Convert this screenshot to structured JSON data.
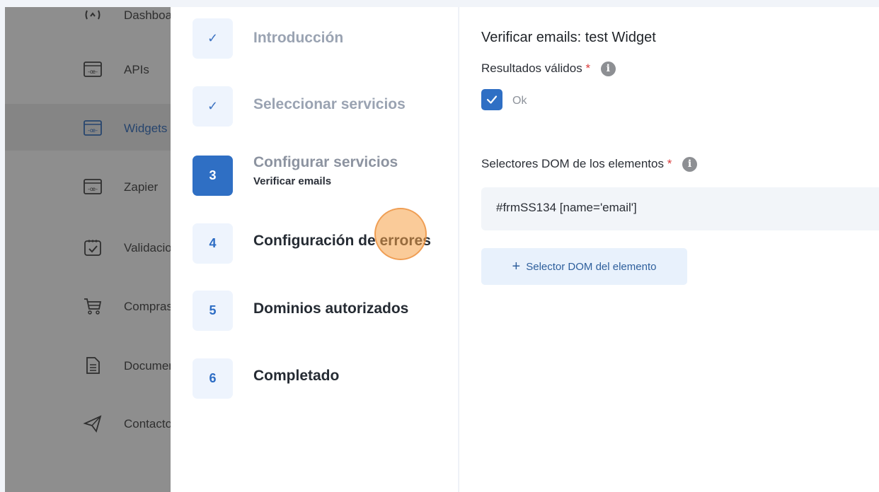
{
  "sidebar": {
    "items": [
      {
        "label": "Dashboard",
        "icon": "dashboard-icon"
      },
      {
        "label": "APIs",
        "icon": "api-icon"
      },
      {
        "label": "Widgets",
        "icon": "widget-icon"
      },
      {
        "label": "Zapier",
        "icon": "zapier-icon"
      },
      {
        "label": "Validaciones",
        "icon": "calendar-check-icon"
      },
      {
        "label": "Compras",
        "icon": "cart-icon"
      },
      {
        "label": "Documentación",
        "icon": "document-icon"
      },
      {
        "label": "Contacto",
        "icon": "send-icon"
      }
    ]
  },
  "wizard": {
    "steps": [
      {
        "marker": "✓",
        "title": "Introducción",
        "state": "done"
      },
      {
        "marker": "✓",
        "title": "Seleccionar servicios",
        "state": "done"
      },
      {
        "marker": "3",
        "title": "Configurar servicios",
        "subtitle": "Verificar emails",
        "state": "active"
      },
      {
        "marker": "4",
        "title": "Configuración de errores",
        "state": "pending"
      },
      {
        "marker": "5",
        "title": "Dominios autorizados",
        "state": "pending"
      },
      {
        "marker": "6",
        "title": "Completado",
        "state": "pending"
      }
    ]
  },
  "content": {
    "title": "Verificar emails: test Widget",
    "valid_results_label": "Resultados válidos",
    "required_mark": "*",
    "info_glyph": "i",
    "ok_checkbox_label": "Ok",
    "ok_checked": true,
    "dom_selectors_label": "Selectores DOM de los elementos",
    "dom_selector_value": "#frmSS134 [name='email']",
    "add_selector_plus": "+",
    "add_selector_label": "Selector DOM del elemento"
  },
  "colors": {
    "accent": "#2f6fc4",
    "required": "#d93a3a",
    "sidebar_overlay": "#8e8e8e",
    "click_highlight": "#f5a046"
  }
}
